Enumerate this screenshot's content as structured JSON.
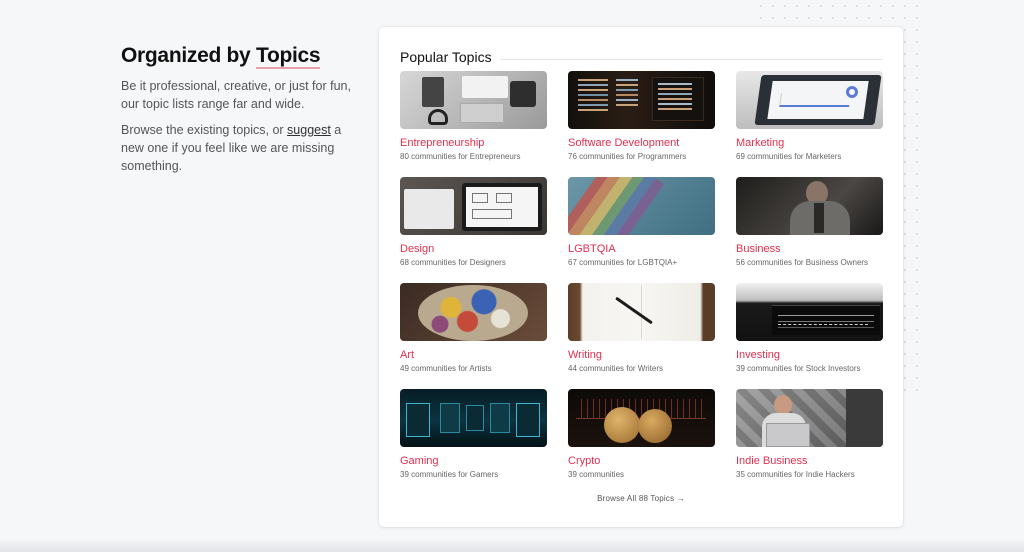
{
  "intro": {
    "title_prefix": "Organized by ",
    "title_highlight": "Topics",
    "para1": "Be it professional, creative, or just for fun, our topic lists range far and wide.",
    "para2_before": "Browse the existing topics, or ",
    "para2_link": "suggest",
    "para2_after": " a new one if you feel like we are missing something."
  },
  "card": {
    "heading": "Popular Topics",
    "browse_label": "Browse All 88 Topics →"
  },
  "topics": [
    {
      "name": "Entrepreneurship",
      "count": "80 communities for Entrepreneurs"
    },
    {
      "name": "Software Development",
      "count": "76 communities for Programmers"
    },
    {
      "name": "Marketing",
      "count": "69 communities for Marketers"
    },
    {
      "name": "Design",
      "count": "68 communities for Designers"
    },
    {
      "name": "LGBTQIA",
      "count": "67 communities for LGBTQIA+"
    },
    {
      "name": "Business",
      "count": "56 communities for Business Owners"
    },
    {
      "name": "Art",
      "count": "49 communities for Artists"
    },
    {
      "name": "Writing",
      "count": "44 communities for Writers"
    },
    {
      "name": "Investing",
      "count": "39 communities for Stock Investors"
    },
    {
      "name": "Gaming",
      "count": "39 communities for Gamers"
    },
    {
      "name": "Crypto",
      "count": "39 communities"
    },
    {
      "name": "Indie Business",
      "count": "35 communities for Indie Hackers"
    }
  ],
  "colors": {
    "accent": "#e0304f",
    "underline": "#e8a0a8",
    "background": "#f6f7f9"
  }
}
